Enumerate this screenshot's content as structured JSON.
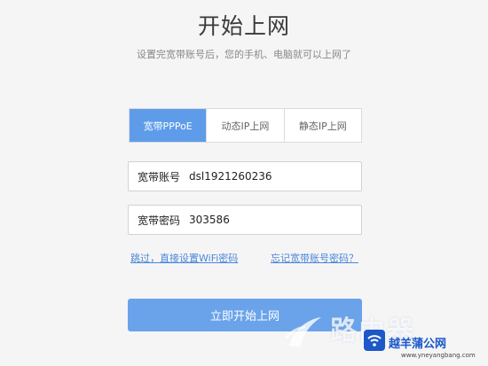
{
  "header": {
    "title": "开始上网",
    "subtitle": "设置完宽带账号后，您的手机、电脑就可以上网了"
  },
  "tabs": [
    {
      "label": "宽带PPPoE",
      "active": true
    },
    {
      "label": "动态IP上网",
      "active": false
    },
    {
      "label": "静态IP上网",
      "active": false
    }
  ],
  "form": {
    "account_label": "宽带账号",
    "account_value": "dsl1921260236",
    "password_label": "宽带密码",
    "password_value": "303586"
  },
  "links": {
    "skip": "跳过，直接设置WiFi密码",
    "forgot": "忘记宽带账号密码？"
  },
  "submit_label": "立即开始上网",
  "watermark": {
    "overlay_text": "路由器",
    "brand": "越羊蒲公网",
    "site": "www.yneyangbang.com"
  },
  "colors": {
    "accent": "#5e9cea",
    "button": "#6aa3ea",
    "link": "#4a86d8",
    "background": "#f5f5f6"
  }
}
